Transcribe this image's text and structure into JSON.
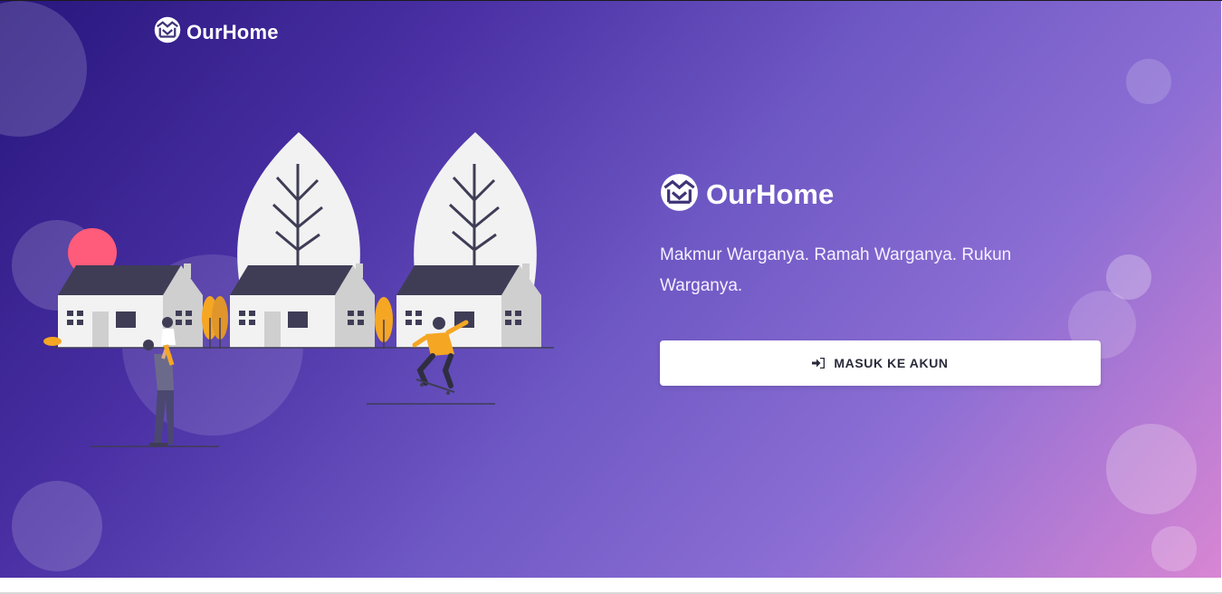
{
  "brand": {
    "name": "OurHome"
  },
  "hero": {
    "tagline": "Makmur Warganya. Ramah Warganya. Rukun Warganya.",
    "login_label": "MASUK KE AKUN"
  },
  "icons": {
    "logo": "house-logo-icon",
    "login": "sign-in-icon"
  },
  "colors": {
    "gradient_start": "#28167d",
    "gradient_mid": "#6e58c4",
    "gradient_end": "#d886d3",
    "accent_yellow": "#f5a623",
    "accent_pink": "#ff5b7a",
    "house_roof": "#3f3d56"
  }
}
